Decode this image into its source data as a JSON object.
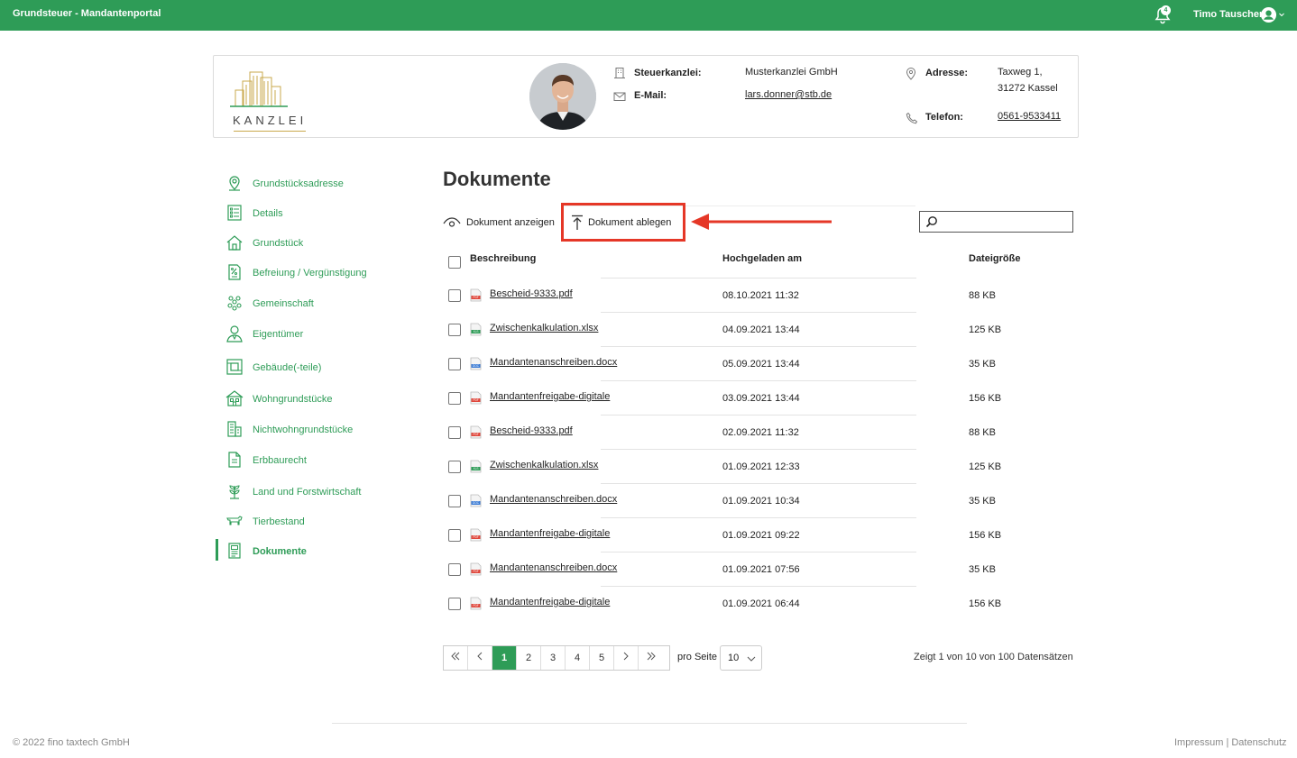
{
  "topbar": {
    "title": "Grundsteuer - Mandantenportal",
    "notification_count": "4",
    "user_name": "Timo Tauscher"
  },
  "profile": {
    "logo_text": "KANZLEI",
    "firm_label": "Steuerkanzlei:",
    "firm_value": "Musterkanzlei GmbH",
    "email_label": "E-Mail:",
    "email_value": "lars.donner@stb.de",
    "address_label": "Adresse:",
    "address_line1": "Taxweg 1,",
    "address_line2": "31272 Kassel",
    "phone_label": "Telefon:",
    "phone_value": "0561-9533411"
  },
  "sidebar": {
    "items": [
      {
        "label": "Grundstücksadresse",
        "icon": "location-pin-icon"
      },
      {
        "label": "Details",
        "icon": "details-list-icon"
      },
      {
        "label": "Grundstück",
        "icon": "house-icon"
      },
      {
        "label": "Befreiung / Vergünstigung",
        "icon": "percent-document-icon"
      },
      {
        "label": "Gemeinschaft",
        "icon": "community-icon"
      },
      {
        "label": "Eigentümer",
        "icon": "owner-person-icon"
      },
      {
        "label": "Gebäude(-teile)",
        "icon": "building-parts-icon"
      },
      {
        "label": "Wohngrundstücke",
        "icon": "residential-icon"
      },
      {
        "label": "Nichtwohngrundstücke",
        "icon": "commercial-building-icon"
      },
      {
        "label": "Erbbaurecht",
        "icon": "document-icon"
      },
      {
        "label": "Land und Forstwirtschaft",
        "icon": "plant-icon"
      },
      {
        "label": "Tierbestand",
        "icon": "cow-icon"
      },
      {
        "label": "Dokumente",
        "icon": "documents-icon"
      }
    ],
    "active_index": 12
  },
  "main": {
    "title": "Dokumente",
    "show_label": "Dokument anzeigen",
    "upload_label": "Dokument ablegen",
    "search_placeholder": ""
  },
  "table": {
    "headers": {
      "description": "Beschreibung",
      "uploaded": "Hochgeladen am",
      "size": "Dateigröße"
    },
    "rows": [
      {
        "name": "Bescheid-9333.pdf",
        "type": "pdf",
        "date": "08.10.2021 11:32",
        "size": "88 KB"
      },
      {
        "name": "Zwischenkalkulation.xlsx",
        "type": "xls",
        "date": "04.09.2021 13:44",
        "size": "125 KB"
      },
      {
        "name": "Mandantenanschreiben.docx",
        "type": "doc",
        "date": "05.09.2021 13:44",
        "size": "35 KB"
      },
      {
        "name": "Mandantenfreigabe-digitale",
        "type": "pdf",
        "date": "03.09.2021 13:44",
        "size": "156 KB"
      },
      {
        "name": "Bescheid-9333.pdf",
        "type": "pdf",
        "date": "02.09.2021 11:32",
        "size": "88 KB"
      },
      {
        "name": "Zwischenkalkulation.xlsx",
        "type": "xls",
        "date": "01.09.2021 12:33",
        "size": "125 KB"
      },
      {
        "name": "Mandantenanschreiben.docx",
        "type": "doc",
        "date": "01.09.2021 10:34",
        "size": "35 KB"
      },
      {
        "name": "Mandantenfreigabe-digitale",
        "type": "pdf",
        "date": "01.09.2021 09:22",
        "size": "156 KB"
      },
      {
        "name": "Mandantenanschreiben.docx",
        "type": "pdf",
        "date": "01.09.2021 07:56",
        "size": "35 KB"
      },
      {
        "name": "Mandantenfreigabe-digitale",
        "type": "pdf",
        "date": "01.09.2021 06:44",
        "size": "156 KB"
      }
    ]
  },
  "pagination": {
    "pages": [
      "1",
      "2",
      "3",
      "4",
      "5"
    ],
    "current": "1",
    "per_page_label": "pro Seite",
    "per_page_value": "10",
    "records_info": "Zeigt 1 von 10 von 100 Datensätzen"
  },
  "footer": {
    "copyright": "© 2022 fino taxtech GmbH",
    "links": "Impressum | Datenschutz"
  },
  "colors": {
    "brand": "#2e9c57",
    "highlight": "#e53727",
    "gold": "#c9a94d"
  }
}
